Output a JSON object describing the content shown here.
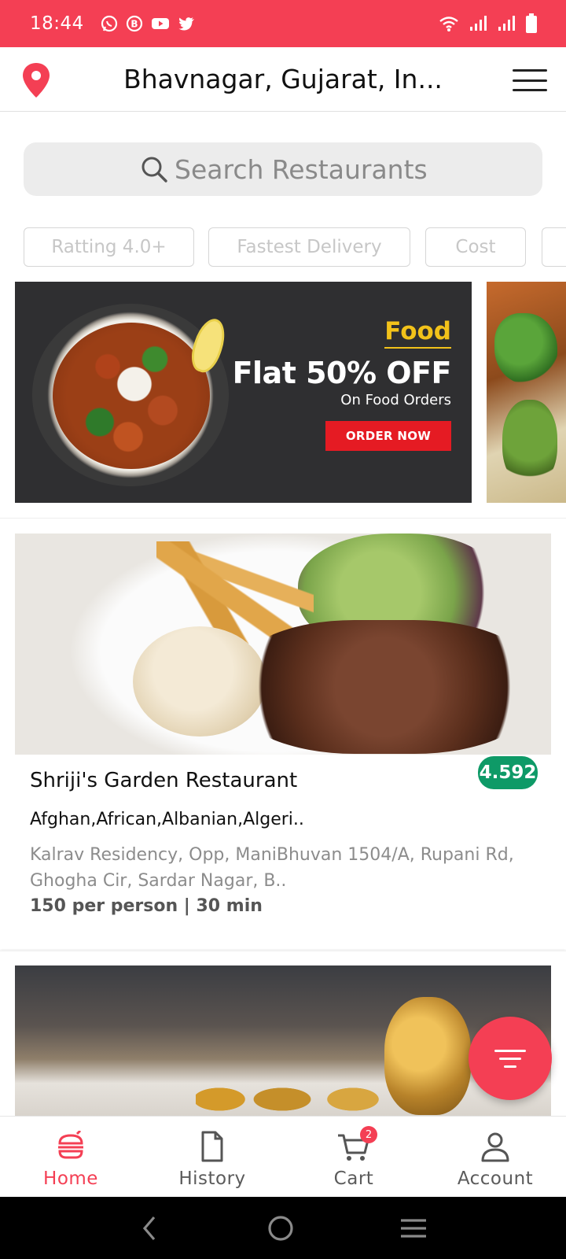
{
  "status_bar": {
    "time": "18:44",
    "app_icons": [
      "whatsapp-icon",
      "b-icon",
      "youtube-icon",
      "twitter-icon"
    ],
    "system_icons": [
      "wifi-icon",
      "signal-icon",
      "signal-icon",
      "battery-icon"
    ],
    "color": "#f43f54"
  },
  "header": {
    "location": "Bhavnagar, Gujarat, In...",
    "pin_icon": "location-pin-icon",
    "menu_icon": "hamburger-menu-icon"
  },
  "search": {
    "placeholder": "Search Restaurants"
  },
  "filters": [
    "Ratting 4.0+",
    "Fastest Delivery",
    "Cost",
    ""
  ],
  "banner": {
    "tag": "Food",
    "headline": "Flat 50% OFF",
    "subtext": "On Food Orders",
    "cta": "ORDER NOW"
  },
  "restaurants": [
    {
      "name": "Shriji's Garden Restaurant",
      "rating": "4.592",
      "cuisines": "Afghan,African,Albanian,Algeri..",
      "address": "Kalrav Residency, Opp, ManiBhuvan 1504/A, Rupani Rd, Ghogha Cir, Sardar Nagar, B..",
      "meta": "150 per person | 30 min"
    }
  ],
  "fab": {
    "icon": "filter-icon"
  },
  "bottom_nav": {
    "items": [
      {
        "label": "Home",
        "icon": "burger-icon",
        "active": true
      },
      {
        "label": "History",
        "icon": "document-icon",
        "active": false
      },
      {
        "label": "Cart",
        "icon": "cart-icon",
        "active": false,
        "badge": "2"
      },
      {
        "label": "Account",
        "icon": "person-icon",
        "active": false
      }
    ]
  },
  "colors": {
    "accent": "#f43f54",
    "rating_green": "#0e9a67",
    "banner_red": "#e51b23",
    "banner_yellow": "#f2c21a"
  }
}
